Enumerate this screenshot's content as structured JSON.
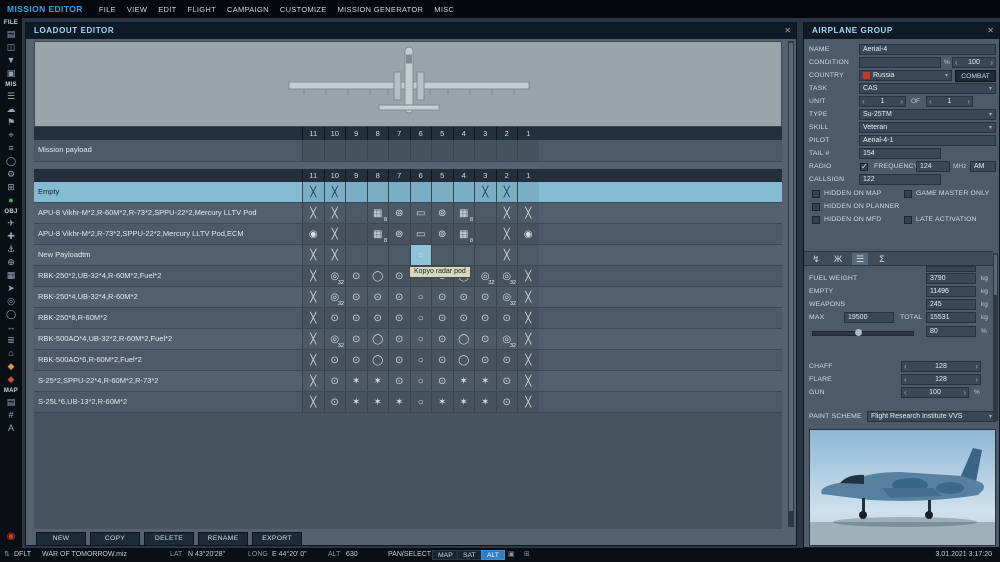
{
  "menu": {
    "title": "MISSION EDITOR",
    "items": [
      "FILE",
      "VIEW",
      "EDIT",
      "FLIGHT",
      "CAMPAIGN",
      "CUSTOMIZE",
      "MISSION GENERATOR",
      "MISC"
    ]
  },
  "sidebar": {
    "sections": [
      {
        "label": "FILE",
        "icons": [
          {
            "name": "new-mission-icon",
            "glyph": "▤"
          },
          {
            "name": "open-mission-icon",
            "glyph": "◫"
          },
          {
            "name": "save-mission-icon",
            "glyph": "▼"
          },
          {
            "name": "recent-files-icon",
            "glyph": "▣"
          }
        ]
      },
      {
        "label": "MIS",
        "icons": [
          {
            "name": "mission-options-icon",
            "glyph": "☰"
          },
          {
            "name": "weather-icon",
            "glyph": "☁"
          },
          {
            "name": "triggers-icon",
            "glyph": "⚑"
          },
          {
            "name": "goals-icon",
            "glyph": "⌖"
          },
          {
            "name": "lists-icon",
            "glyph": "≡"
          },
          {
            "name": "trigger-zones-icon",
            "glyph": "◯"
          },
          {
            "name": "generator-icon",
            "glyph": "⚙"
          },
          {
            "name": "templates-icon",
            "glyph": "⊞"
          },
          {
            "name": "start-icon",
            "glyph": "●",
            "color": "#3db56b"
          }
        ]
      },
      {
        "label": "OBJ",
        "icons": [
          {
            "name": "airplane-icon",
            "glyph": "✈"
          },
          {
            "name": "helicopter-icon",
            "glyph": "✚"
          },
          {
            "name": "ship-icon",
            "glyph": "⚓"
          },
          {
            "name": "vehicle-icon",
            "glyph": "⊕"
          },
          {
            "name": "static-object-icon",
            "glyph": "▦"
          },
          {
            "name": "rocket-icon",
            "glyph": "➤"
          },
          {
            "name": "bullseye-icon",
            "glyph": "◎"
          },
          {
            "name": "zone-icon",
            "glyph": "◯"
          },
          {
            "name": "distance-icon",
            "glyph": "↔"
          },
          {
            "name": "sequence-icon",
            "glyph": "≣"
          },
          {
            "name": "farp-icon",
            "glyph": "⌂"
          },
          {
            "name": "warehouse-icon",
            "glyph": "◆",
            "color": "#d89a3a"
          },
          {
            "name": "alert-icon",
            "glyph": "◆",
            "color": "#c94f3f"
          }
        ]
      },
      {
        "label": "MAP",
        "icons": [
          {
            "name": "layers-icon",
            "glyph": "▤"
          },
          {
            "name": "grid-icon",
            "glyph": "#"
          },
          {
            "name": "labels-icon",
            "glyph": "A"
          }
        ]
      }
    ],
    "record_icon": {
      "name": "record-icon",
      "glyph": "◉",
      "color": "#d03a2e"
    }
  },
  "loadout": {
    "title": "LOADOUT EDITOR",
    "close": "✕",
    "pylons": [
      "11",
      "10",
      "9",
      "8",
      "7",
      "6",
      "5",
      "4",
      "3",
      "2",
      "1"
    ],
    "mission_payload_label": "Mission payload",
    "tooltip": "Kopyo radar pod",
    "icon_map": {
      "x": "╳",
      "b": "⊙",
      "o": "○",
      "p": "▭",
      "v": "⊚",
      "d": "▦",
      "r": "◎",
      "f": "◯",
      "s": "✶",
      "O": "◉"
    },
    "rows": [
      {
        "name": "Empty",
        "selected": true,
        "cells": [
          "x",
          "x",
          "",
          "",
          "",
          "",
          "",
          "",
          "x",
          "x",
          ""
        ]
      },
      {
        "name": "APU-8 Vikhr-M*2,R-60M*2,R-73*2,SPPU-22*2,Mercury LLTV Pod",
        "cells": [
          "x",
          "x",
          "",
          "d:8",
          "v",
          "p",
          "v",
          "d:8",
          "",
          "x",
          "x"
        ]
      },
      {
        "name": "APU-8 Vikhr-M*2,R-73*2,SPPU-22*2,Mercury LLTV Pod,ECM",
        "cells": [
          "O",
          "x",
          "",
          "d:8",
          "v",
          "p",
          "v",
          "d:8",
          "",
          "x",
          "O"
        ]
      },
      {
        "name": "New Payloadtm",
        "cells": [
          "x",
          "x",
          "",
          "",
          "",
          "o!",
          "",
          "",
          "",
          "x",
          ""
        ]
      },
      {
        "name": "RBK-250*2,UB-32*4,R-60M*2,Fuel*2",
        "cells": [
          "x",
          "r:32",
          "b",
          "f",
          "b",
          "o",
          "b",
          "f",
          "r:32",
          "r:32",
          "x"
        ]
      },
      {
        "name": "RBK-250*4,UB-32*4,R-60M*2",
        "cells": [
          "x",
          "r:32",
          "b",
          "b",
          "b",
          "o",
          "b",
          "b",
          "b",
          "r:32",
          "x"
        ]
      },
      {
        "name": "RBK-250*8,R-60M*2",
        "cells": [
          "x",
          "b",
          "b",
          "b",
          "b",
          "o",
          "b",
          "b",
          "b",
          "b",
          "x"
        ]
      },
      {
        "name": "RBK-500AO*4,UB-32*2,R-60M*2,Fuel*2",
        "cells": [
          "x",
          "r:32",
          "b",
          "f",
          "b",
          "o",
          "b",
          "f",
          "b",
          "r:32",
          "x"
        ]
      },
      {
        "name": "RBK-500AO*6,R-60M*2,Fuel*2",
        "cells": [
          "x",
          "b",
          "b",
          "f",
          "b",
          "o",
          "b",
          "f",
          "b",
          "b",
          "x"
        ]
      },
      {
        "name": "S-25*2,SPPU-22*4,R-60M*2,R-73*2",
        "cells": [
          "x",
          "b",
          "s",
          "s",
          "b",
          "o",
          "b",
          "s",
          "s",
          "b",
          "x"
        ]
      },
      {
        "name": "S-25L*6,UB-13*2,R-60M*2",
        "cells": [
          "x",
          "b",
          "s",
          "s",
          "s",
          "o",
          "s",
          "s",
          "s",
          "b",
          "x"
        ]
      }
    ],
    "buttons": [
      "NEW",
      "COPY",
      "DELETE",
      "RENAME",
      "EXPORT"
    ]
  },
  "group": {
    "title": "AIRPLANE GROUP",
    "close": "✕",
    "name_label": "NAME",
    "name_value": "Aerial-4",
    "condition_label": "CONDITION",
    "condition_value": "",
    "percent": "%",
    "condition_num": "100",
    "country_label": "COUNTRY",
    "country_value": "Russia",
    "combat_label": "COMBAT",
    "task_label": "TASK",
    "task_value": "CAS",
    "unit_label": "UNIT",
    "unit_value": "1",
    "unit_of_label": "OF",
    "unit_total": "1",
    "type_label": "TYPE",
    "type_value": "Su-25TM",
    "skill_label": "SKILL",
    "skill_value": "Veteran",
    "pilot_label": "PILOT",
    "pilot_value": "Aerial-4-1",
    "tail_label": "TAIL #",
    "tail_value": "154",
    "radio_label": "RADIO",
    "frequency_label": "FREQUENCY",
    "frequency_value": "124",
    "frequency_unit": "MHz",
    "modulation": "AM",
    "callsign_label": "CALLSIGN",
    "callsign_value": "122",
    "checks": [
      {
        "label": "HIDDEN ON MAP"
      },
      {
        "label": "GAME MASTER ONLY"
      },
      {
        "label": "HIDDEN ON PLANNER"
      },
      {
        "label": "HIDDEN ON MFD"
      },
      {
        "label": "LATE ACTIVATION"
      }
    ],
    "fuel_label": "FUEL WEIGHT",
    "fuel_value": "3790",
    "kg_unit": "kg",
    "empty_label": "EMPTY",
    "empty_value": "11496",
    "weapons_label": "WEAPONS",
    "weapons_value": "245",
    "max_label": "MAX",
    "max_value": "19500",
    "total_label": "TOTAL",
    "total_value": "15531",
    "fuel_percent": "80",
    "chaff_label": "CHAFF",
    "chaff_value": "128",
    "flare_label": "FLARE",
    "flare_value": "128",
    "gun_label": "GUN",
    "gun_value": "100",
    "paint_label": "PAINT SCHEME",
    "paint_value": "Flight Research Institute  VVS"
  },
  "statusbar": {
    "mode": "DFLT",
    "file": "WAR OF TOMORROW.miz",
    "lat_label": "LAT",
    "lat_value": "N 43°20'28\"",
    "long_label": "LONG",
    "long_value": "E 44°20' 0\"",
    "alt_label": "ALT",
    "alt_value": "630",
    "tool": "PAN/SELECT",
    "layers": [
      "MAP",
      "SAT",
      "ALT"
    ],
    "active_layer": "ALT",
    "datetime": "3.01.2021 3:17:20"
  }
}
